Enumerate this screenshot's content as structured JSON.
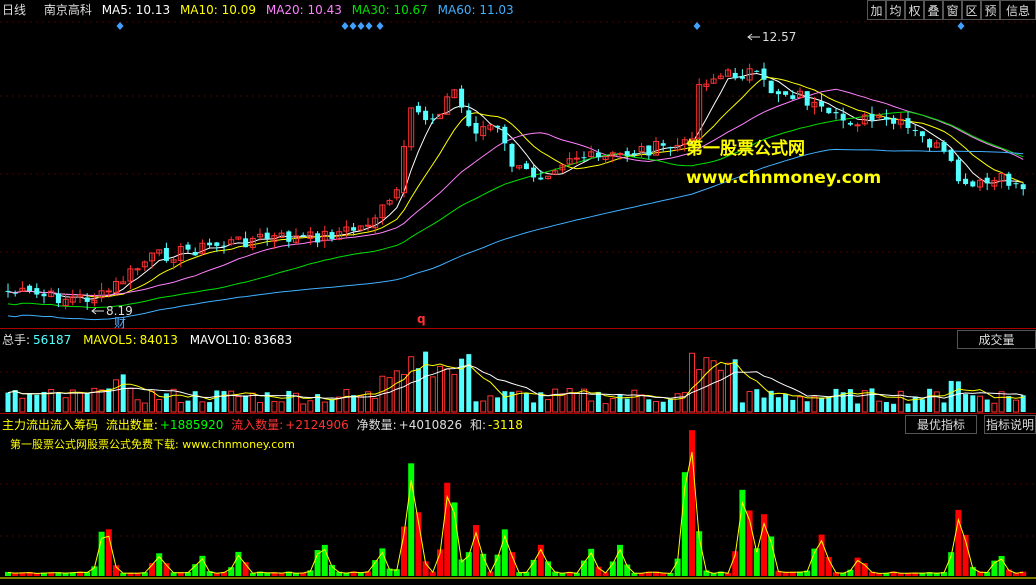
{
  "header": {
    "period": "日线",
    "stock_name": "南京高科",
    "ma5_label": "MA5:",
    "ma5_value": "10.13",
    "ma10_label": "MA10:",
    "ma10_value": "10.09",
    "ma20_label": "MA20:",
    "ma20_value": "10.43",
    "ma30_label": "MA30:",
    "ma30_value": "10.67",
    "ma60_label": "MA60:",
    "ma60_value": "11.03"
  },
  "toolbar": {
    "items": [
      "加",
      "均",
      "权",
      "叠",
      "窗",
      "区",
      "预",
      "信息"
    ]
  },
  "price_chart": {
    "high_marker": "12.57",
    "low_marker": "8.19",
    "low_badge": "财",
    "q_marker": "q",
    "watermark_title": "第一股票公式网",
    "watermark_url": "www.chnmoney.com"
  },
  "volume_panel": {
    "total_label": "总手:",
    "total_value": "56187",
    "mavol5_label": "MAVOL5:",
    "mavol5_value": "84013",
    "mavol10_label": "MAVOL10:",
    "mavol10_value": "83683",
    "button_label": "成交量"
  },
  "indicator_panel": {
    "name": "主力流出流入筹码",
    "outflow_label": "流出数量:",
    "outflow_value": "+1885920",
    "inflow_label": "流入数量:",
    "inflow_value": "+2124906",
    "net_label": "净数量:",
    "net_value": "+4010826",
    "sum_label": "和:",
    "sum_value": "-3118",
    "promo_text": "第一股票公式网股票公式免费下载: www.chnmoney.com",
    "best_button": "最优指标",
    "help_button": "指标说明"
  },
  "colors": {
    "up": "#ff3232",
    "down": "#54ffff",
    "ma5": "#ffffff",
    "ma10": "#ffff00",
    "ma20": "#ff80ff",
    "ma30": "#00e000",
    "ma60": "#40b0ff",
    "separator": "#aa0000",
    "indicator_green": "#00ff00",
    "indicator_red": "#ff0000"
  }
}
